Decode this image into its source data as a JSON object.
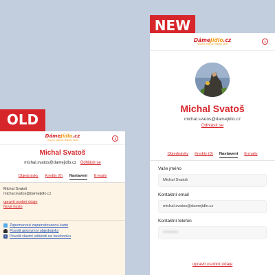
{
  "badges": {
    "old": "OLD",
    "new": "NEW"
  },
  "logo": {
    "text_main": "Dáme",
    "text_accent": "Jídlo",
    "text_suffix": ".cz",
    "slogan": "Rozvoz jídla do Vašeho okolí"
  },
  "old": {
    "user_name": "Michal Svatoš",
    "email": "michal.svatos@damejidlo.cz",
    "logout": "Odhlásit se",
    "tabs": [
      {
        "label": "Objednávky",
        "active": false
      },
      {
        "label": "Kredity (0)",
        "active": false
      },
      {
        "label": "Nastavení",
        "active": true
      },
      {
        "label": "E-maily",
        "active": false
      }
    ],
    "details": {
      "name": "Michal Svatoš",
      "email": "michal.svatos@damejidlo.cz"
    },
    "edit_link": "upravit osobní údaje",
    "new_password_link": "Nové heslo",
    "social": [
      {
        "icon": "twitter-icon",
        "label": "Zapomenout zapamatovanou kartu"
      },
      {
        "icon": "person-icon",
        "label": "Povolit anonymní objednávky"
      },
      {
        "icon": "facebook-icon",
        "label": "Povolit vlastní události na facebooku"
      }
    ]
  },
  "new": {
    "user_name": "Michal Svatoš",
    "email": "michal.svatos@damejidlo.cz",
    "logout": "Odhlásit se",
    "tabs": [
      {
        "label": "Objednávky",
        "active": false
      },
      {
        "label": "Kredity (0)",
        "active": false
      },
      {
        "label": "Nastavení",
        "active": true
      },
      {
        "label": "E-maily",
        "active": false
      }
    ],
    "fields": [
      {
        "label": "Vaše jméno",
        "value": "Michal Svatoš"
      },
      {
        "label": "Kontaktní email",
        "value": "michal.svatos@damejidlo.cz"
      },
      {
        "label": "Kontaktní telefon",
        "value": "•••••••••••"
      }
    ],
    "edit_link": "upravit osobní údaje"
  },
  "colors": {
    "brand_red": "#d7262b",
    "brand_orange": "#f29b16",
    "background": "#c2cede"
  }
}
